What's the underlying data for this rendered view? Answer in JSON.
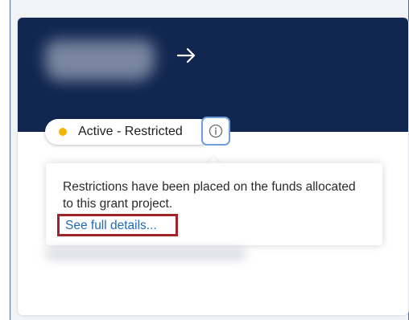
{
  "card": {
    "status_label": "Active - Restricted",
    "status_color": "#f2b705",
    "header_color": "#112750",
    "arrow_icon": "arrow-right-icon",
    "info_icon": "info-circle-icon"
  },
  "tooltip": {
    "text": "Restrictions have been placed on the funds allocated to this grant project.",
    "link_label": "See full details..."
  }
}
